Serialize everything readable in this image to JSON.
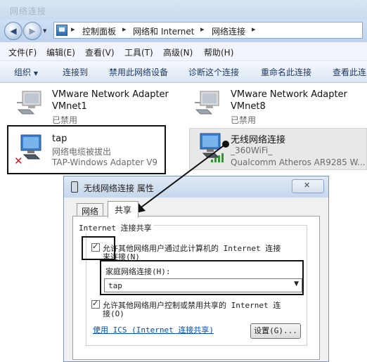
{
  "window": {
    "title_blur": "网络连接"
  },
  "address": {
    "crumbs": [
      "控制面板",
      "网络和 Internet",
      "网络连接"
    ],
    "separator": "▸"
  },
  "menu": [
    "文件(F)",
    "编辑(E)",
    "查看(V)",
    "工具(T)",
    "高级(N)",
    "帮助(H)"
  ],
  "toolbar": {
    "organize": "组织",
    "connect_to": "连接到",
    "disable": "禁用此网络设备",
    "diagnose": "诊断这个连接",
    "rename": "重命名此连接",
    "view_status": "查看此连"
  },
  "adapters": [
    {
      "name": "VMware Network Adapter",
      "line2": "VMnet1",
      "status": "已禁用"
    },
    {
      "name": "VMware Network Adapter",
      "line2": "VMnet8",
      "status": "已禁用"
    },
    {
      "name": "tap",
      "line2": "网络电缆被拔出",
      "status": "TAP-Windows Adapter V9"
    },
    {
      "name": "无线网络连接",
      "line2": "_360WiFi_",
      "status": "Qualcomm Atheros AR9285 W..."
    }
  ],
  "dialog": {
    "title": "无线网络连接 属性",
    "tabs": [
      "网络",
      "共享"
    ],
    "group_title": "Internet 连接共享",
    "allow_share_line1": "允许其他网络用户通过此计算机的 Internet 连接",
    "allow_share_line2": "来连接(N)",
    "home_label": "家庭网络连接(H):",
    "home_value": "tap",
    "allow_control_line1": "允许其他网络用户控制或禁用共享的 Internet 连",
    "allow_control_line2": "接(O)",
    "ics_link": "使用 ICS (Internet 连接共享)",
    "settings": "设置(G)..."
  },
  "colors": {
    "accent": "#0050c0",
    "toolbar_text": "#1e3a66",
    "highlight": "#111111"
  }
}
